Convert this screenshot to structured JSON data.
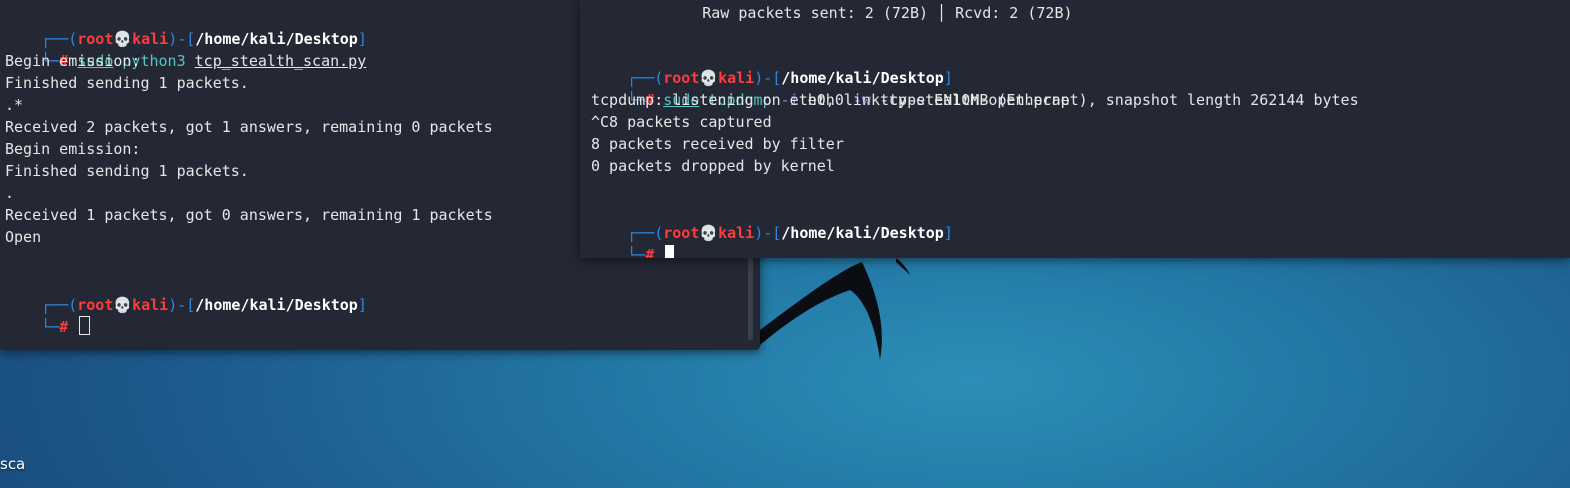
{
  "prompt": {
    "open": "(",
    "user": "root",
    "skull": "💀",
    "host": "kali",
    "close": ")-[",
    "path": "/home/kali/Desktop",
    "end": "]",
    "hash": "#"
  },
  "left_terminal": {
    "command": {
      "sudo": "sudo",
      "program": "python3",
      "script": "tcp_stealth_scan.py"
    },
    "output": [
      "Begin emission:",
      "Finished sending 1 packets.",
      ".*",
      "Received 2 packets, got 1 answers, remaining 0 packets",
      "Begin emission:",
      "Finished sending 1 packets.",
      ".",
      "Received 1 packets, got 0 answers, remaining 1 packets",
      "Open"
    ]
  },
  "right_terminal": {
    "top_line": "        Raw packets sent: 2 (72B) │ Rcvd: 2 (72B)",
    "command": {
      "sudo": "sudo",
      "program": "tcpdump",
      "opt_i": "-i",
      "iface": "eth0",
      "opt_w": "-w",
      "file": "tcp-stealth-open.pcap"
    },
    "output": [
      "tcpdump: listening on eth0, link-type EN10MB (Ethernet), snapshot length 262144 bytes",
      "^C8 packets captured",
      "8 packets received by filter",
      "0 packets dropped by kernel"
    ]
  },
  "desktop": {
    "label": "sca"
  },
  "colors": {
    "terminal_bg": "#232834",
    "prompt_box": "#2f86e6",
    "user_red": "#ff3b3b",
    "command_teal": "#56c7c1",
    "option_purple": "#9a7cf2",
    "desktop_blue": "#2378a6"
  }
}
